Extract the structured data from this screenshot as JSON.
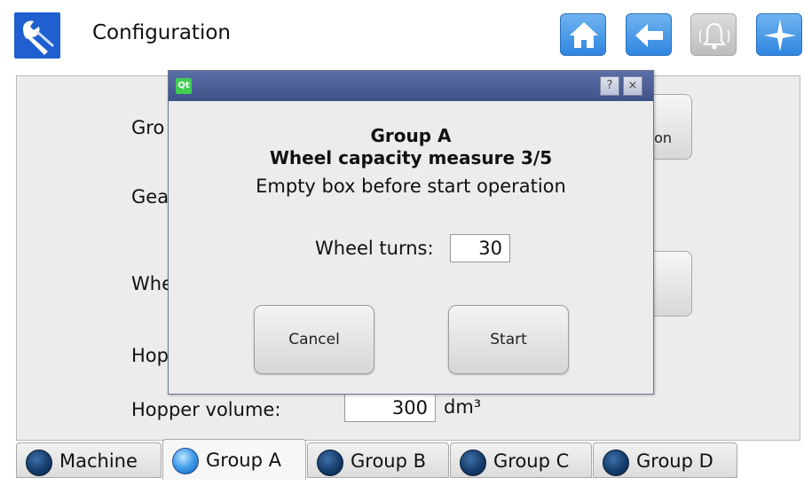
{
  "header": {
    "title": "Configuration",
    "app_icon": "wrench-icon",
    "buttons": [
      {
        "name": "home-icon"
      },
      {
        "name": "back-arrow-icon"
      },
      {
        "name": "alarm-bell-icon",
        "state": "disabled"
      },
      {
        "name": "compass-star-icon"
      }
    ]
  },
  "panel": {
    "rows": [
      {
        "label": "Gro"
      },
      {
        "label": "Gea"
      },
      {
        "label": "Whe"
      },
      {
        "label": "Hop"
      }
    ],
    "side_button_label": "on",
    "hopper_volume": {
      "label": "Hopper volume:",
      "value": "300",
      "unit": "dm³"
    }
  },
  "tabs": [
    {
      "label": "Machine",
      "active": false
    },
    {
      "label": "Group A",
      "active": true
    },
    {
      "label": "Group B",
      "active": false
    },
    {
      "label": "Group C",
      "active": false
    },
    {
      "label": "Group D",
      "active": false
    }
  ],
  "dialog": {
    "titlebar_icon": "Qt",
    "help_button": "?",
    "close_button": "×",
    "line1": "Group A",
    "line2": "Wheel capacity measure 3/5",
    "line3": "Empty box before start operation",
    "wheel_turns_label": "Wheel turns:",
    "wheel_turns_value": "30",
    "cancel_label": "Cancel",
    "start_label": "Start"
  },
  "colors": {
    "accent_blue": "#2f86df",
    "titlebar": "#4a5c93",
    "panel_bg": "#ececec"
  }
}
